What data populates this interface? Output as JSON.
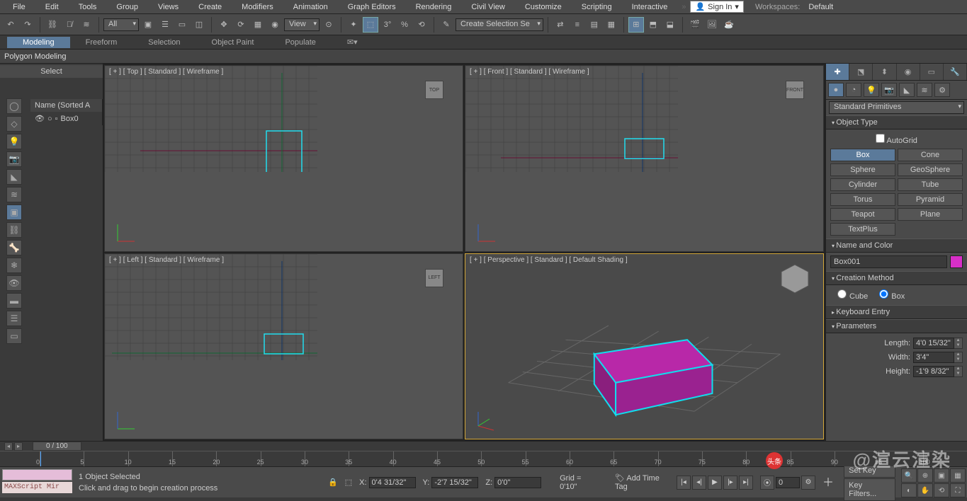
{
  "menu": {
    "items": [
      "File",
      "Edit",
      "Tools",
      "Group",
      "Views",
      "Create",
      "Modifiers",
      "Animation",
      "Graph Editors",
      "Rendering",
      "Civil View",
      "Customize",
      "Scripting",
      "Interactive"
    ],
    "signin": "Sign In",
    "workspaces_label": "Workspaces:",
    "workspaces_value": "Default"
  },
  "toolbar": {
    "dd_all": "All",
    "dd_view": "View",
    "dd_selset": "Create Selection Se"
  },
  "ribbon": {
    "tabs": [
      "Modeling",
      "Freeform",
      "Selection",
      "Object Paint",
      "Populate"
    ],
    "active": 0,
    "sub": "Polygon Modeling"
  },
  "scene": {
    "panel_title": "Select",
    "tree_header": "Name (Sorted A",
    "root": "Box0"
  },
  "viewports": {
    "top": {
      "label": "[ + ] [ Top ] [ Standard ] [ Wireframe ]",
      "cube": "TOP"
    },
    "front": {
      "label": "[ + ] [ Front ] [ Standard ] [ Wireframe ]",
      "cube": "FRONT"
    },
    "left": {
      "label": "[ + ] [ Left ] [ Standard ] [ Wireframe ]",
      "cube": "LEFT"
    },
    "persp": {
      "label": "[ + ] [ Perspective ] [ Standard ] [ Default Shading ]",
      "cube": ""
    }
  },
  "cmd": {
    "dropdown": "Standard Primitives",
    "object_type": {
      "title": "Object Type",
      "autogrid": "AutoGrid",
      "buttons": [
        "Box",
        "Cone",
        "Sphere",
        "GeoSphere",
        "Cylinder",
        "Tube",
        "Torus",
        "Pyramid",
        "Teapot",
        "Plane",
        "TextPlus"
      ],
      "active": 0
    },
    "name_color": {
      "title": "Name and Color",
      "value": "Box001",
      "color": "#d82fc8"
    },
    "creation": {
      "title": "Creation Method",
      "options": [
        "Cube",
        "Box"
      ],
      "selected": 1
    },
    "keyboard": {
      "title": "Keyboard Entry"
    },
    "params": {
      "title": "Parameters",
      "length_l": "Length:",
      "length_v": "4'0 15/32\"",
      "width_l": "Width:",
      "width_v": "3'4\"",
      "height_l": "Height:",
      "height_v": "-1'9 8/32\""
    }
  },
  "time": {
    "slider": "0 / 100",
    "ticks": [
      0,
      5,
      10,
      15,
      20,
      25,
      30,
      35,
      40,
      45,
      50,
      55,
      60,
      65,
      70,
      75,
      80,
      85,
      90,
      95,
      100
    ]
  },
  "status": {
    "maxscript": "MAXScript Mir",
    "selected": "1 Object Selected",
    "hint": "Click and drag to begin creation process",
    "x_l": "X:",
    "x_v": "0'4 31/32\"",
    "y_l": "Y:",
    "y_v": "-2'7 15/32\"",
    "z_l": "Z:",
    "z_v": "0'0\"",
    "grid": "Grid = 0'10\"",
    "addtime": "Add Time Tag",
    "setkey": "Set Key",
    "keyfilters": "Key Filters...",
    "frame": "0"
  },
  "watermark": "@渲云渲染",
  "wm_badge": "头条"
}
